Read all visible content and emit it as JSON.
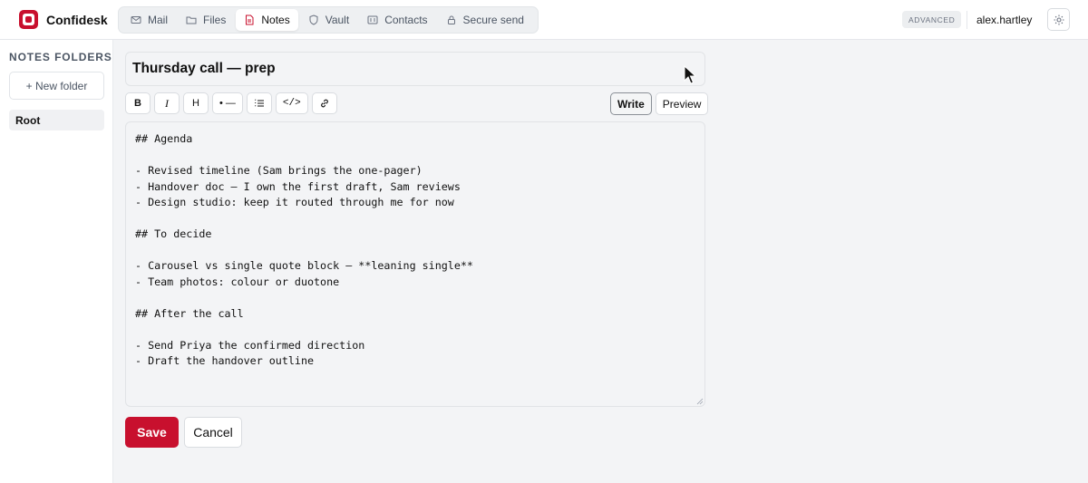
{
  "app": {
    "name": "Confidesk",
    "brand_color": "#c8102e"
  },
  "nav": {
    "tabs": [
      {
        "label": "Mail",
        "icon": "mail-icon",
        "active": false
      },
      {
        "label": "Files",
        "icon": "folder-icon",
        "active": false
      },
      {
        "label": "Notes",
        "icon": "document-icon",
        "active": true
      },
      {
        "label": "Vault",
        "icon": "shield-icon",
        "active": false
      },
      {
        "label": "Contacts",
        "icon": "contact-card-icon",
        "active": false
      },
      {
        "label": "Secure send",
        "icon": "lock-icon",
        "active": false
      }
    ]
  },
  "header": {
    "mode_badge": "ADVANCED",
    "username": "alex.hartley",
    "settings_icon": "gear-icon"
  },
  "sidebar": {
    "title": "NOTES FOLDERS",
    "new_folder_label": "+ New folder",
    "folders": [
      {
        "label": "Root",
        "selected": true
      }
    ]
  },
  "note": {
    "title": "Thursday call — prep",
    "toolbar": {
      "bold": "B",
      "italic": "I",
      "heading": "H",
      "bullet_list": "• —",
      "code": "</>"
    },
    "modes": {
      "write": "Write",
      "preview": "Preview",
      "active": "write"
    },
    "body": "## Agenda\n\n- Revised timeline (Sam brings the one-pager)\n- Handover doc — I own the first draft, Sam reviews\n- Design studio: keep it routed through me for now\n\n## To decide\n\n- Carousel vs single quote block — **leaning single**\n- Team photos: colour or duotone\n\n## After the call\n\n- Send Priya the confirmed direction\n- Draft the handover outline"
  },
  "actions": {
    "save": "Save",
    "cancel": "Cancel"
  }
}
